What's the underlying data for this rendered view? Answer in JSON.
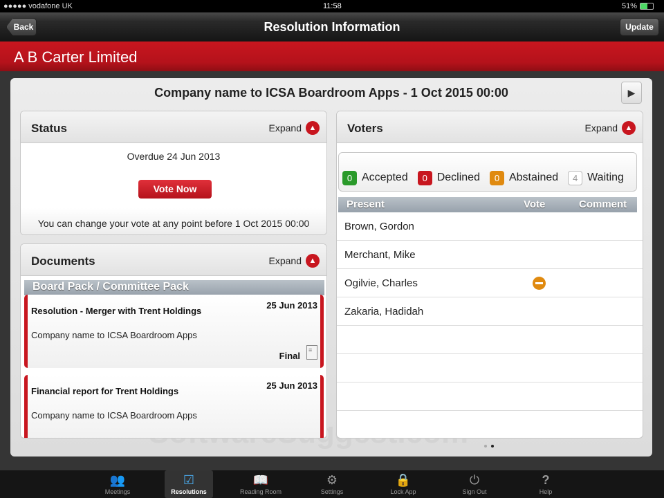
{
  "status_bar": {
    "carrier": "●●●●● vodafone UK",
    "time": "11:58",
    "battery": "51%"
  },
  "nav": {
    "back": "Back",
    "title": "Resolution Information",
    "update": "Update"
  },
  "company": "A B Carter Limited",
  "resolution_title": "Company name to ICSA Boardroom Apps - 1 Oct 2015 00:00",
  "status": {
    "title": "Status",
    "expand": "Expand",
    "overdue": "Overdue 24 Jun 2013",
    "vote_now": "Vote Now",
    "note": "You can change your vote at any point before 1 Oct 2015 00:00"
  },
  "documents": {
    "title": "Documents",
    "expand": "Expand",
    "section": "Board Pack / Committee Pack",
    "items": [
      {
        "title": "Resolution - Merger with Trent Holdings",
        "date": "25 Jun 2013",
        "subtitle": "Company name to ICSA Boardroom Apps",
        "status": "Final"
      },
      {
        "title": "Financial report for Trent Holdings",
        "date": "25 Jun 2013",
        "subtitle": "Company name to ICSA Boardroom Apps"
      }
    ]
  },
  "voters": {
    "title": "Voters",
    "expand": "Expand",
    "summary": [
      {
        "count": "0",
        "label": "Accepted",
        "color": "#2a9a2a"
      },
      {
        "count": "0",
        "label": "Declined",
        "color": "#c8161f"
      },
      {
        "count": "0",
        "label": "Abstained",
        "color": "#e08a10"
      },
      {
        "count": "4",
        "label": "Waiting",
        "color": "#ffffff"
      }
    ],
    "columns": {
      "present": "Present",
      "vote": "Vote",
      "comment": "Comment"
    },
    "rows": [
      {
        "name": "Brown, Gordon"
      },
      {
        "name": "Merchant, Mike"
      },
      {
        "name": "Ogilvie, Charles",
        "vote": "abstain-icon"
      },
      {
        "name": "Zakaria, Hadidah"
      }
    ]
  },
  "watermark": "SoftwareSuggest.com",
  "tabs": [
    {
      "label": "Meetings",
      "icon": "people-icon"
    },
    {
      "label": "Resolutions",
      "icon": "checkbox-icon",
      "active": true
    },
    {
      "label": "Reading Room",
      "icon": "book-icon"
    },
    {
      "label": "Settings",
      "icon": "gear-icon"
    },
    {
      "label": "Lock App",
      "icon": "lock-icon"
    },
    {
      "label": "Sign Out",
      "icon": "power-icon"
    },
    {
      "label": "Help",
      "icon": "help-icon"
    }
  ]
}
